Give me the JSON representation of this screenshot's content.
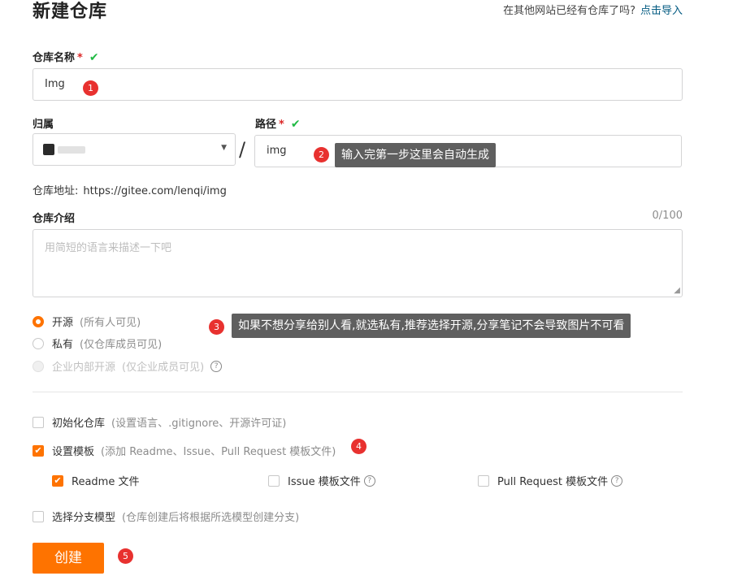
{
  "page": {
    "title": "新建仓库",
    "import_question": "在其他网站已经有仓库了吗?",
    "import_link": "点击导入"
  },
  "repo_name": {
    "label": "仓库名称",
    "required_mark": "*",
    "value": "Img"
  },
  "owner": {
    "label": "归属"
  },
  "path": {
    "label": "路径",
    "required_mark": "*",
    "separator": "/",
    "value": "img"
  },
  "repo_address": {
    "label": "仓库地址:",
    "url": "https://gitee.com/lenqi/img"
  },
  "intro": {
    "label": "仓库介绍",
    "count": "0/100",
    "placeholder": "用简短的语言来描述一下吧"
  },
  "visibility": {
    "options": [
      {
        "label": "开源",
        "note": "(所有人可见)",
        "selected": true,
        "disabled": false
      },
      {
        "label": "私有",
        "note": "(仅仓库成员可见)",
        "selected": false,
        "disabled": false
      },
      {
        "label": "企业内部开源",
        "note": "(仅企业成员可见)",
        "selected": false,
        "disabled": true
      }
    ]
  },
  "init_repo": {
    "label": "初始化仓库",
    "note": "(设置语言、.gitignore、开源许可证)",
    "checked": false
  },
  "templates": {
    "label": "设置模板",
    "note": "(添加 Readme、Issue、Pull Request 模板文件)",
    "checked": true,
    "items": [
      {
        "label": "Readme 文件",
        "checked": true
      },
      {
        "label": "Issue 模板文件",
        "checked": false
      },
      {
        "label": "Pull Request 模板文件",
        "checked": false
      }
    ]
  },
  "branch_model": {
    "label": "选择分支模型",
    "note": "(仓库创建后将根据所选模型创建分支)",
    "checked": false
  },
  "create_button": "创建",
  "annotations": {
    "badges": [
      "1",
      "2",
      "3",
      "4",
      "5"
    ],
    "tip2": "输入完第一步这里会自动生成",
    "tip3": "如果不想分享给别人看,就选私有,推荐选择开源,分享笔记不会导致图片不可看"
  },
  "colors": {
    "accent": "#fe7300",
    "success": "#21ba45",
    "badge": "#e8312f",
    "link": "#005980"
  }
}
